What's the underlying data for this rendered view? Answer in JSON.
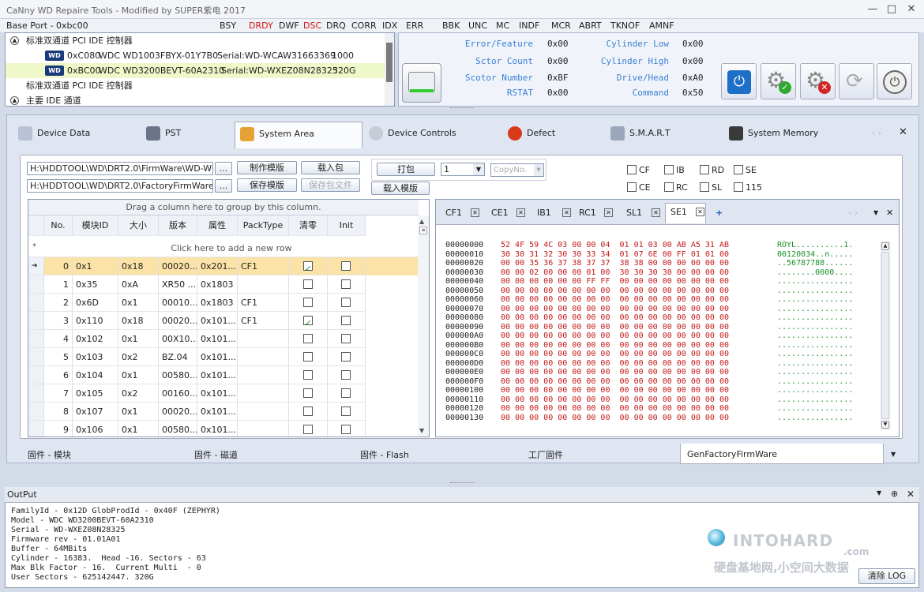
{
  "window": {
    "title": "CaNny WD Repaire Tools - Modified by SUPER紫电 2017",
    "minimize": "—",
    "maximize": "□",
    "close": "✕"
  },
  "status": {
    "base_port": "Base Port - 0xbc00",
    "flags": [
      {
        "label": "BSY",
        "color": "#222222"
      },
      {
        "label": "DRDY",
        "color": "#d41414"
      },
      {
        "label": "DWF",
        "color": "#222222"
      },
      {
        "label": "DSC",
        "color": "#d41414"
      },
      {
        "label": "DRQ",
        "color": "#222222"
      },
      {
        "label": "CORR",
        "color": "#222222"
      },
      {
        "label": "IDX",
        "color": "#222222"
      },
      {
        "label": "ERR",
        "color": "#222222"
      },
      {
        "label": "BBK",
        "color": "#222222"
      },
      {
        "label": "UNC",
        "color": "#222222"
      },
      {
        "label": "MC",
        "color": "#222222"
      },
      {
        "label": "INDF",
        "color": "#222222"
      },
      {
        "label": "MCR",
        "color": "#222222"
      },
      {
        "label": "ABRT",
        "color": "#222222"
      },
      {
        "label": "TKNOF",
        "color": "#222222"
      },
      {
        "label": "AMNF",
        "color": "#222222"
      }
    ]
  },
  "devices": [
    {
      "type": "group",
      "text": "标准双通道 PCI IDE 控制器"
    },
    {
      "type": "drive",
      "port": "0xC080",
      "model": "WDC WD1003FBYX-01Y7B0",
      "serial": "Serial:WD-WCAW31663369",
      "size": "1000"
    },
    {
      "type": "drive",
      "port": "0xBC00",
      "model": "WDC WD3200BEVT-60A2310",
      "serial": "Serial:WD-WXEZ08N28325",
      "size": "320G"
    },
    {
      "type": "group",
      "text": "标准双通道 PCI IDE 控制器"
    },
    {
      "type": "group",
      "text": "主要 IDE 通道"
    }
  ],
  "registers": {
    "left": [
      {
        "label": "Error/Feature",
        "value": "0x00"
      },
      {
        "label": "Sctor Count",
        "value": "0x00"
      },
      {
        "label": "Scotor Number",
        "value": "0xBF"
      },
      {
        "label": "RSTAT",
        "value": "0x00"
      }
    ],
    "right": [
      {
        "label": "Cylinder Low",
        "value": "0x00"
      },
      {
        "label": "Cylinder High",
        "value": "0x00"
      },
      {
        "label": "Drive/Head",
        "value": "0xA0"
      },
      {
        "label": "Command",
        "value": "0x50"
      }
    ]
  },
  "tabs": [
    "Device Data",
    "PST",
    "System Area",
    "Device Controls",
    "Defect",
    "S.M.A.R.T",
    "System Memory"
  ],
  "sysarea": {
    "path1": "H:\\HDDTOOL\\WD\\DRT2.0\\FirmWare\\WD-WC",
    "path2": "H:\\HDDTOOL\\WD\\DRT2.0\\FactoryFirmWare\\T",
    "browse": "...",
    "make_template": "制作模版",
    "load_pack": "载入包",
    "save_template": "保存模版",
    "save_pack": "保存包文件",
    "pack": "打包",
    "count": "1",
    "copyno": "CopyNo.",
    "load_template": "载入模版",
    "checks": [
      {
        "label": "CF",
        "checked": false
      },
      {
        "label": "IB",
        "checked": false
      },
      {
        "label": "RD",
        "checked": false
      },
      {
        "label": "SE",
        "checked": false
      },
      {
        "label": "CE",
        "checked": false
      },
      {
        "label": "RC",
        "checked": false
      },
      {
        "label": "SL",
        "checked": false
      },
      {
        "label": "115",
        "checked": false
      }
    ]
  },
  "grid": {
    "group_hint": "Drag a column here to group by this column.",
    "add_row": "Click here to add a new row",
    "columns": [
      "No.",
      "模块ID",
      "大小",
      "版本",
      "属性",
      "PackType",
      "清零",
      "Init"
    ],
    "rows": [
      {
        "no": "0",
        "id": "0x1",
        "size": "0x18",
        "ver": "00020...",
        "attr": "0x201...",
        "pack": "CF1",
        "clear": true,
        "init": false
      },
      {
        "no": "1",
        "id": "0x35",
        "size": "0xA",
        "ver": "XR50 ...",
        "attr": "0x1803",
        "pack": "",
        "clear": false,
        "init": false
      },
      {
        "no": "2",
        "id": "0x6D",
        "size": "0x1",
        "ver": "00010...",
        "attr": "0x1803",
        "pack": "CF1",
        "clear": false,
        "init": false
      },
      {
        "no": "3",
        "id": "0x110",
        "size": "0x18",
        "ver": "00020...",
        "attr": "0x101...",
        "pack": "CF1",
        "clear": true,
        "init": false
      },
      {
        "no": "4",
        "id": "0x102",
        "size": "0x1",
        "ver": "00X10...",
        "attr": "0x101...",
        "pack": "",
        "clear": false,
        "init": false
      },
      {
        "no": "5",
        "id": "0x103",
        "size": "0x2",
        "ver": "BZ.04",
        "attr": "0x101...",
        "pack": "",
        "clear": false,
        "init": false
      },
      {
        "no": "6",
        "id": "0x104",
        "size": "0x1",
        "ver": "00580...",
        "attr": "0x101...",
        "pack": "",
        "clear": false,
        "init": false
      },
      {
        "no": "7",
        "id": "0x105",
        "size": "0x2",
        "ver": "00160...",
        "attr": "0x101...",
        "pack": "",
        "clear": false,
        "init": false
      },
      {
        "no": "8",
        "id": "0x107",
        "size": "0x1",
        "ver": "00020...",
        "attr": "0x101...",
        "pack": "",
        "clear": false,
        "init": false
      },
      {
        "no": "9",
        "id": "0x106",
        "size": "0x1",
        "ver": "00580...",
        "attr": "0x101...",
        "pack": "",
        "clear": false,
        "init": false
      }
    ]
  },
  "hex": {
    "tabs": [
      "CF1",
      "CE1",
      "IB1",
      "RC1",
      "SL1",
      "SE1"
    ],
    "active": "SE1",
    "lines": [
      {
        "addr": "00000000",
        "bytes": "52 4F 59 4C 03 00 00 04  01 01 03 00 AB A5 31 AB",
        "ascii": "ROYL..........1."
      },
      {
        "addr": "00000010",
        "bytes": "30 30 31 32 30 30 33 34  01 07 6E 00 FF 01 01 00",
        "ascii": "00120034..n....."
      },
      {
        "addr": "00000020",
        "bytes": "00 00 35 36 37 38 37 37  38 38 00 00 00 00 00 00",
        "ascii": "..56787788......"
      },
      {
        "addr": "00000030",
        "bytes": "00 00 02 00 00 00 01 00  30 30 30 30 00 00 00 00",
        "ascii": "........0000...."
      },
      {
        "addr": "00000040",
        "bytes": "00 00 00 00 00 00 FF FF  00 00 00 00 00 00 00 00",
        "ascii": "................"
      },
      {
        "addr": "00000050",
        "bytes": "00 00 00 00 00 00 00 00  00 00 00 00 00 00 00 00",
        "ascii": "................"
      },
      {
        "addr": "00000060",
        "bytes": "00 00 00 00 00 00 00 00  00 00 00 00 00 00 00 00",
        "ascii": "................"
      },
      {
        "addr": "00000070",
        "bytes": "00 00 00 00 00 00 00 00  00 00 00 00 00 00 00 00",
        "ascii": "................"
      },
      {
        "addr": "00000080",
        "bytes": "00 00 00 00 00 00 00 00  00 00 00 00 00 00 00 00",
        "ascii": "................"
      },
      {
        "addr": "00000090",
        "bytes": "00 00 00 00 00 00 00 00  00 00 00 00 00 00 00 00",
        "ascii": "................"
      },
      {
        "addr": "000000A0",
        "bytes": "00 00 00 00 00 00 00 00  00 00 00 00 00 00 00 00",
        "ascii": "................"
      },
      {
        "addr": "000000B0",
        "bytes": "00 00 00 00 00 00 00 00  00 00 00 00 00 00 00 00",
        "ascii": "................"
      },
      {
        "addr": "000000C0",
        "bytes": "00 00 00 00 00 00 00 00  00 00 00 00 00 00 00 00",
        "ascii": "................"
      },
      {
        "addr": "000000D0",
        "bytes": "00 00 00 00 00 00 00 00  00 00 00 00 00 00 00 00",
        "ascii": "................"
      },
      {
        "addr": "000000E0",
        "bytes": "00 00 00 00 00 00 00 00  00 00 00 00 00 00 00 00",
        "ascii": "................"
      },
      {
        "addr": "000000F0",
        "bytes": "00 00 00 00 00 00 00 00  00 00 00 00 00 00 00 00",
        "ascii": "................"
      },
      {
        "addr": "00000100",
        "bytes": "00 00 00 00 00 00 00 00  00 00 00 00 00 00 00 00",
        "ascii": "................"
      },
      {
        "addr": "00000110",
        "bytes": "00 00 00 00 00 00 00 00  00 00 00 00 00 00 00 00",
        "ascii": "................"
      },
      {
        "addr": "00000120",
        "bytes": "00 00 00 00 00 00 00 00  00 00 00 00 00 00 00 00",
        "ascii": "................"
      },
      {
        "addr": "00000130",
        "bytes": "00 00 00 00 00 00 00 00  00 00 00 00 00 00 00 00",
        "ascii": "................"
      }
    ]
  },
  "bottom_tabs": [
    "固件 - 模块",
    "固件 - 磁道",
    "固件 - Flash",
    "工厂固件",
    "GenFactoryFirmWare"
  ],
  "output": {
    "title": "OutPut",
    "clear_log": "清除 LOG",
    "lines": [
      "FamilyId - 0x12D GlobProdId - 0x40F (ZEPHYR)",
      "Model - WDC WD3200BEVT-60A2310",
      "Serial - WD-WXEZ08N28325",
      "Firmware rev - 01.01A01",
      "Buffer - 64MBits",
      "Cylinder - 16383.  Head -16. Sectors - 63",
      "Max Blk Factor - 16.  Current Multi  - 0",
      "User Sectors - 625142447. 320G"
    ]
  },
  "watermark": {
    "brand": "INTOHARD",
    "tld": ".com",
    "slogan": "硬盘基地网,小空间大数据"
  },
  "colors": {
    "accent": "#3a7fd4",
    "error_flag": "#d41414",
    "hex_ascii": "#1a8f2a",
    "selected_row": "#fbe2a6"
  }
}
